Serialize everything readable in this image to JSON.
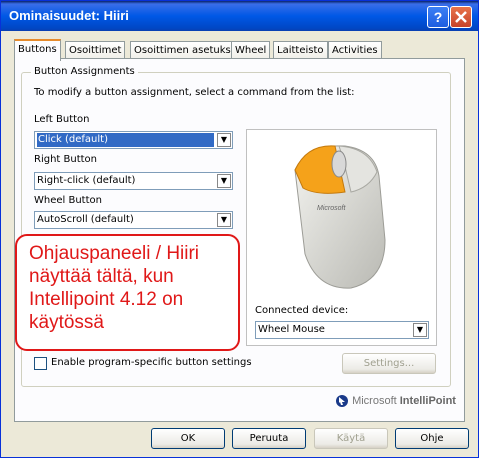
{
  "window": {
    "title": "Ominaisuudet: Hiiri",
    "help_label": "?",
    "close_label": "✕"
  },
  "tabs": [
    {
      "label": "Buttons"
    },
    {
      "label": "Osoittimet"
    },
    {
      "label": "Osoittimen asetukset"
    },
    {
      "label": "Wheel"
    },
    {
      "label": "Laitteisto"
    },
    {
      "label": "Activities"
    }
  ],
  "assignments": {
    "group_title": "Button Assignments",
    "instruction": "To modify a button assignment, select a command from the list:",
    "left_label": "Left Button",
    "left_value": "Click (default)",
    "right_label": "Right Button",
    "right_value": "Right-click (default)",
    "wheel_label": "Wheel Button",
    "wheel_value": "AutoScroll (default)"
  },
  "device": {
    "connected_label": "Connected device:",
    "connected_value": "Wheel Mouse",
    "mouse_logo": "Microsoft"
  },
  "annotation": {
    "line1": "Ohjauspaneeli / Hiiri",
    "line2": "näyttää tältä, kun",
    "line3": "Intellipoint 4.12  on",
    "line4": "käytössä"
  },
  "program_specific": {
    "label": "Enable program-specific button settings",
    "checked": false
  },
  "settings_button": "Settings...",
  "brand": {
    "prefix": "Microsoft ",
    "name": "IntelliPoint"
  },
  "footer": {
    "ok": "OK",
    "cancel": "Peruuta",
    "apply": "Käytä",
    "help": "Ohje"
  },
  "colors": {
    "title_bar": "#0054e3",
    "tab_accent": "#e68b2c",
    "annotation": "#e01818",
    "mouse_button": "#f5a21a"
  }
}
